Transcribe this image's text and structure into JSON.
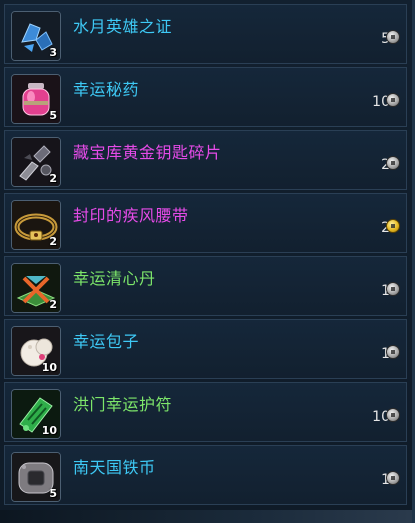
{
  "colors": {
    "name_cyan": "#3ec9f5",
    "name_magenta": "#e64be8",
    "name_green": "#7de66a"
  },
  "items": [
    {
      "name": "水月英雄之证",
      "quantity": "3",
      "price": "5",
      "currency": "silver",
      "name_color": "#3ec9f5",
      "icon": "blue-crystal-icon"
    },
    {
      "name": "幸运秘药",
      "quantity": "5",
      "price": "10",
      "currency": "silver",
      "name_color": "#3ec9f5",
      "icon": "pink-potion-jar-icon"
    },
    {
      "name": "藏宝库黄金钥匙碎片",
      "quantity": "2",
      "price": "2",
      "currency": "silver",
      "name_color": "#e64be8",
      "icon": "key-fragment-icon"
    },
    {
      "name": "封印的疾风腰带",
      "quantity": "2",
      "price": "2",
      "currency": "gold",
      "name_color": "#e64be8",
      "icon": "belt-icon"
    },
    {
      "name": "幸运清心丹",
      "quantity": "2",
      "price": "1",
      "currency": "silver",
      "name_color": "#7de66a",
      "icon": "pill-box-icon"
    },
    {
      "name": "幸运包子",
      "quantity": "10",
      "price": "1",
      "currency": "silver",
      "name_color": "#3ec9f5",
      "icon": "steamed-bun-icon"
    },
    {
      "name": "洪门幸运护符",
      "quantity": "10",
      "price": "10",
      "currency": "silver",
      "name_color": "#7de66a",
      "icon": "green-talisman-icon"
    },
    {
      "name": "南天国铁币",
      "quantity": "5",
      "price": "1",
      "currency": "silver",
      "name_color": "#3ec9f5",
      "icon": "iron-coin-icon"
    }
  ]
}
